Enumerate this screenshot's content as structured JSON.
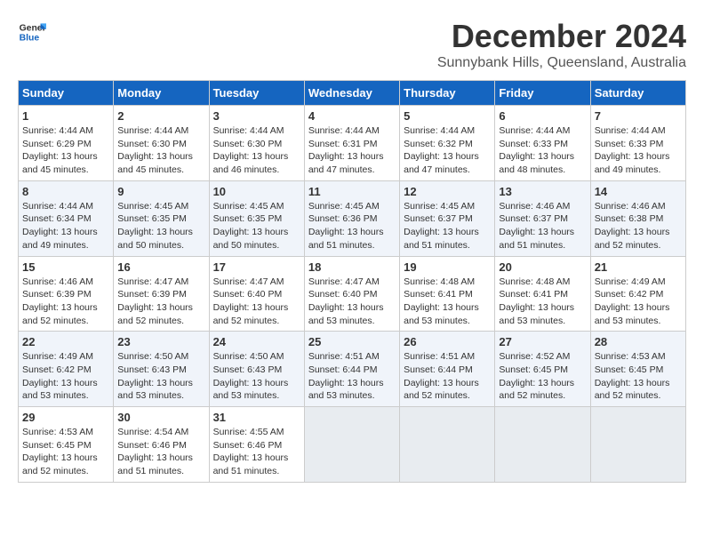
{
  "logo": {
    "line1": "General",
    "line2": "Blue"
  },
  "title": "December 2024",
  "subtitle": "Sunnybank Hills, Queensland, Australia",
  "weekdays": [
    "Sunday",
    "Monday",
    "Tuesday",
    "Wednesday",
    "Thursday",
    "Friday",
    "Saturday"
  ],
  "weeks": [
    [
      {
        "day": "1",
        "info": "Sunrise: 4:44 AM\nSunset: 6:29 PM\nDaylight: 13 hours\nand 45 minutes."
      },
      {
        "day": "2",
        "info": "Sunrise: 4:44 AM\nSunset: 6:30 PM\nDaylight: 13 hours\nand 45 minutes."
      },
      {
        "day": "3",
        "info": "Sunrise: 4:44 AM\nSunset: 6:30 PM\nDaylight: 13 hours\nand 46 minutes."
      },
      {
        "day": "4",
        "info": "Sunrise: 4:44 AM\nSunset: 6:31 PM\nDaylight: 13 hours\nand 47 minutes."
      },
      {
        "day": "5",
        "info": "Sunrise: 4:44 AM\nSunset: 6:32 PM\nDaylight: 13 hours\nand 47 minutes."
      },
      {
        "day": "6",
        "info": "Sunrise: 4:44 AM\nSunset: 6:33 PM\nDaylight: 13 hours\nand 48 minutes."
      },
      {
        "day": "7",
        "info": "Sunrise: 4:44 AM\nSunset: 6:33 PM\nDaylight: 13 hours\nand 49 minutes."
      }
    ],
    [
      {
        "day": "8",
        "info": "Sunrise: 4:44 AM\nSunset: 6:34 PM\nDaylight: 13 hours\nand 49 minutes."
      },
      {
        "day": "9",
        "info": "Sunrise: 4:45 AM\nSunset: 6:35 PM\nDaylight: 13 hours\nand 50 minutes."
      },
      {
        "day": "10",
        "info": "Sunrise: 4:45 AM\nSunset: 6:35 PM\nDaylight: 13 hours\nand 50 minutes."
      },
      {
        "day": "11",
        "info": "Sunrise: 4:45 AM\nSunset: 6:36 PM\nDaylight: 13 hours\nand 51 minutes."
      },
      {
        "day": "12",
        "info": "Sunrise: 4:45 AM\nSunset: 6:37 PM\nDaylight: 13 hours\nand 51 minutes."
      },
      {
        "day": "13",
        "info": "Sunrise: 4:46 AM\nSunset: 6:37 PM\nDaylight: 13 hours\nand 51 minutes."
      },
      {
        "day": "14",
        "info": "Sunrise: 4:46 AM\nSunset: 6:38 PM\nDaylight: 13 hours\nand 52 minutes."
      }
    ],
    [
      {
        "day": "15",
        "info": "Sunrise: 4:46 AM\nSunset: 6:39 PM\nDaylight: 13 hours\nand 52 minutes."
      },
      {
        "day": "16",
        "info": "Sunrise: 4:47 AM\nSunset: 6:39 PM\nDaylight: 13 hours\nand 52 minutes."
      },
      {
        "day": "17",
        "info": "Sunrise: 4:47 AM\nSunset: 6:40 PM\nDaylight: 13 hours\nand 52 minutes."
      },
      {
        "day": "18",
        "info": "Sunrise: 4:47 AM\nSunset: 6:40 PM\nDaylight: 13 hours\nand 53 minutes."
      },
      {
        "day": "19",
        "info": "Sunrise: 4:48 AM\nSunset: 6:41 PM\nDaylight: 13 hours\nand 53 minutes."
      },
      {
        "day": "20",
        "info": "Sunrise: 4:48 AM\nSunset: 6:41 PM\nDaylight: 13 hours\nand 53 minutes."
      },
      {
        "day": "21",
        "info": "Sunrise: 4:49 AM\nSunset: 6:42 PM\nDaylight: 13 hours\nand 53 minutes."
      }
    ],
    [
      {
        "day": "22",
        "info": "Sunrise: 4:49 AM\nSunset: 6:42 PM\nDaylight: 13 hours\nand 53 minutes."
      },
      {
        "day": "23",
        "info": "Sunrise: 4:50 AM\nSunset: 6:43 PM\nDaylight: 13 hours\nand 53 minutes."
      },
      {
        "day": "24",
        "info": "Sunrise: 4:50 AM\nSunset: 6:43 PM\nDaylight: 13 hours\nand 53 minutes."
      },
      {
        "day": "25",
        "info": "Sunrise: 4:51 AM\nSunset: 6:44 PM\nDaylight: 13 hours\nand 53 minutes."
      },
      {
        "day": "26",
        "info": "Sunrise: 4:51 AM\nSunset: 6:44 PM\nDaylight: 13 hours\nand 52 minutes."
      },
      {
        "day": "27",
        "info": "Sunrise: 4:52 AM\nSunset: 6:45 PM\nDaylight: 13 hours\nand 52 minutes."
      },
      {
        "day": "28",
        "info": "Sunrise: 4:53 AM\nSunset: 6:45 PM\nDaylight: 13 hours\nand 52 minutes."
      }
    ],
    [
      {
        "day": "29",
        "info": "Sunrise: 4:53 AM\nSunset: 6:45 PM\nDaylight: 13 hours\nand 52 minutes."
      },
      {
        "day": "30",
        "info": "Sunrise: 4:54 AM\nSunset: 6:46 PM\nDaylight: 13 hours\nand 51 minutes."
      },
      {
        "day": "31",
        "info": "Sunrise: 4:55 AM\nSunset: 6:46 PM\nDaylight: 13 hours\nand 51 minutes."
      },
      null,
      null,
      null,
      null
    ]
  ]
}
